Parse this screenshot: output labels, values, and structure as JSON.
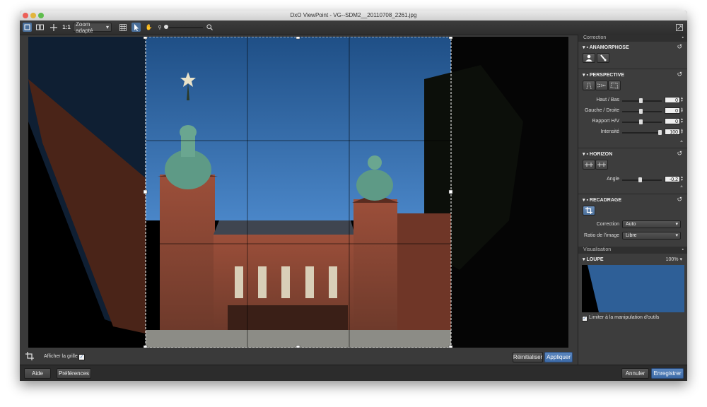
{
  "window": {
    "title": "DxO ViewPoint - VG--SDM2__20110708_2261.jpg"
  },
  "toolbar": {
    "ratio_label": "1:1",
    "zoom_value": "Zoom adapté",
    "icons": [
      "single-view-icon",
      "split-view-icon",
      "pan-icon",
      "grid-icon",
      "pointer-icon",
      "hand-icon",
      "zoom-out-icon",
      "zoom-in-icon",
      "fullscreen-icon"
    ]
  },
  "bottom": {
    "grid_toggle_label": "Afficher la grille",
    "reset_label": "Réinitialiser",
    "apply_label": "Appliquer"
  },
  "footer": {
    "help_label": "Aide",
    "prefs_label": "Préférences",
    "cancel_label": "Annuler",
    "save_label": "Enregistrer"
  },
  "panel": {
    "correction_header": "Correction",
    "anamorphose": {
      "title": "ANAMORPHOSE"
    },
    "perspective": {
      "title": "PERSPECTIVE",
      "sliders": [
        {
          "label": "Haut / Bas",
          "value": "0",
          "level": 0.5
        },
        {
          "label": "Gauche / Droite",
          "value": "0",
          "level": 0.5
        },
        {
          "label": "Rapport H/V",
          "value": "0",
          "level": 0.5
        },
        {
          "label": "Intensité",
          "value": "100",
          "level": 1.0
        }
      ]
    },
    "horizon": {
      "title": "HORIZON",
      "slider": {
        "label": "Angle",
        "value": "-0.2",
        "level": 0.48
      }
    },
    "recadrage": {
      "title": "RECADRAGE",
      "correction_label": "Correction",
      "correction_value": "Auto",
      "ratio_label": "Ratio de l'image",
      "ratio_value": "Libre"
    },
    "visualisation_header": "Visualisation",
    "loupe": {
      "title": "LOUPE",
      "zoom": "100%",
      "limit_label": "Limiter à la manipulation d'outils"
    }
  },
  "colors": {
    "accent": "#4a6f9a",
    "sky": "#2e5f97",
    "brick": "#8a4a38"
  }
}
